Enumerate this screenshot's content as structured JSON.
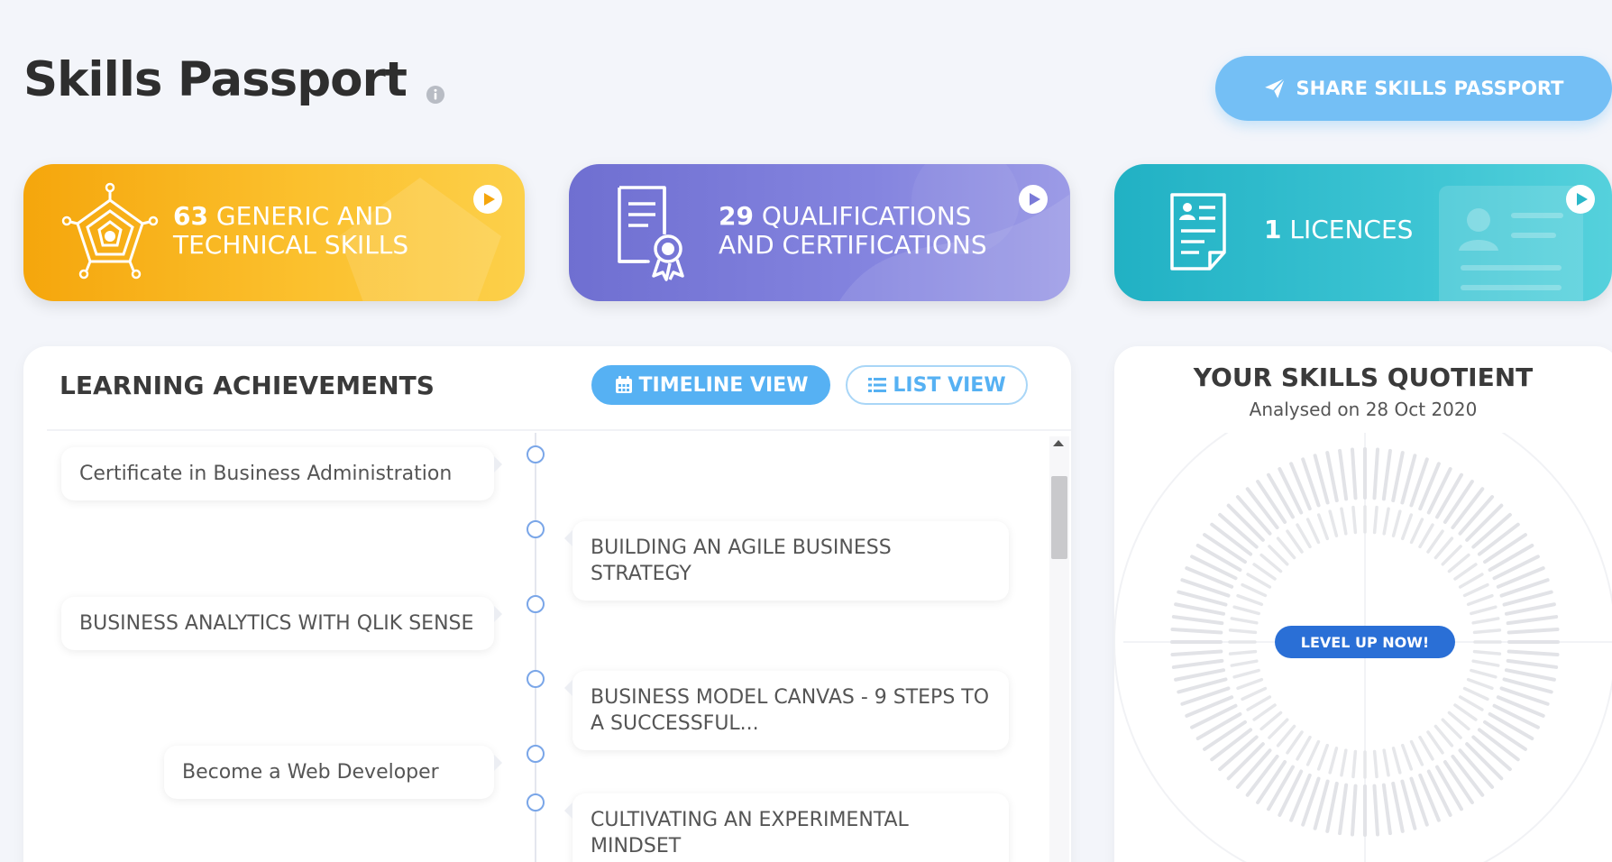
{
  "header": {
    "title": "Skills Passport",
    "share_label": "SHARE SKILLS PASSPORT"
  },
  "cards": {
    "skills": {
      "count": "63",
      "label_line1": " GENERIC AND",
      "label_line2": "TECHNICAL SKILLS"
    },
    "qualifications": {
      "count": "29",
      "label_line1": " QUALIFICATIONS",
      "label_line2": "AND CERTIFICATIONS"
    },
    "licences": {
      "count": "1",
      "label": " LICENCES"
    }
  },
  "learning": {
    "title": "LEARNING ACHIEVEMENTS",
    "timeline_label": "TIMELINE VIEW",
    "list_label": "LIST VIEW",
    "entries": [
      {
        "side": "left",
        "text": "Certificate in Business Administration"
      },
      {
        "side": "right",
        "text": "BUILDING AN AGILE BUSINESS STRATEGY"
      },
      {
        "side": "left",
        "text": "BUSINESS ANALYTICS WITH QLIK SENSE"
      },
      {
        "side": "right",
        "text": "BUSINESS MODEL CANVAS - 9 STEPS TO A SUCCESSFUL..."
      },
      {
        "side": "left",
        "text": "Become a Web Developer"
      },
      {
        "side": "right",
        "text": "CULTIVATING AN EXPERIMENTAL MINDSET"
      }
    ]
  },
  "quotient": {
    "title": "YOUR SKILLS QUOTIENT",
    "subtitle": "Analysed on 28 Oct 2020",
    "cta_label": "LEVEL UP NOW!"
  },
  "colors": {
    "accent": "#56b1f3",
    "skills_card": "#f5a60c",
    "qualifications_card": "#7a7ad8",
    "licences_card": "#2bb8c9",
    "cta": "#2a6fd6"
  }
}
